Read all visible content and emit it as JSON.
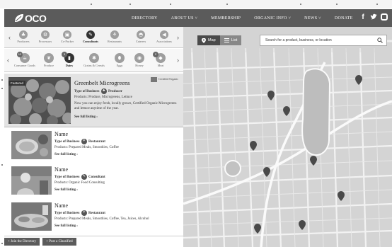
{
  "header": {
    "logo_text": "OCO",
    "nav": [
      "DIRECTORY",
      "ABOUT US ˅",
      "MEMBERSHIP",
      "ORGANIC INFO ˅",
      "NEWS ˅",
      "DONATE"
    ],
    "social": [
      "facebook-icon",
      "twitter-icon",
      "instagram-icon"
    ]
  },
  "categories": [
    {
      "label": "Producers",
      "icon": "producer-icon"
    },
    {
      "label": "Processors",
      "icon": "processor-icon"
    },
    {
      "label": "Co-Packer",
      "icon": "copacker-icon"
    },
    {
      "label": "Consultants",
      "icon": "consultant-icon",
      "active": true
    },
    {
      "label": "Restaurants",
      "icon": "restaurant-icon"
    },
    {
      "label": "Caterers",
      "icon": "caterer-icon"
    },
    {
      "label": "Associations",
      "icon": "association-icon"
    }
  ],
  "subcategories": [
    {
      "label": "Consumer Goods",
      "icon": "consumer-goods-icon",
      "badge": "12"
    },
    {
      "label": "Produce",
      "icon": "produce-icon"
    },
    {
      "label": "Dairy",
      "icon": "dairy-icon",
      "badge": "3",
      "active": true
    },
    {
      "label": "Grains & Cereals",
      "icon": "grains-icon"
    },
    {
      "label": "Eggs",
      "icon": "eggs-icon"
    },
    {
      "label": "Honey",
      "icon": "honey-icon"
    },
    {
      "label": "Meat",
      "icon": "meat-icon",
      "badge": "2"
    }
  ],
  "featured": {
    "tag": "Featured",
    "title": "Greenbelt Microgreens",
    "type_label": "Type of Business",
    "type_value": "Producer",
    "products_label": "Products:",
    "products_value": "Produce, Microgreens, Lettuce",
    "description": "Now you can enjoy fresh, locally grown, Certified Organic Microgreens and lettuce anytime of the year.",
    "more": "See full listing ›",
    "certified": "Certified Organic"
  },
  "listings": [
    {
      "name": "Name",
      "type_label": "Type of Business",
      "type_value": "Restaurant",
      "products": "Products: Prepared Meals, Smoothies, Coffee",
      "more": "See full listing ›"
    },
    {
      "name": "Name",
      "type_label": "Type of Business",
      "type_value": "Consultant",
      "products": "Products: Organic Food Consulting",
      "more": "See full listing ›"
    },
    {
      "name": "Name",
      "type_label": "Type of Business",
      "type_value": "Restaurant",
      "products": "Products: Prepared Meals, Smoothies, Coffee, Tea, Juices, Alcohol",
      "more": "See full listing ›"
    }
  ],
  "buttons": {
    "join": "+ Join the Directory",
    "classified": "+ Post a Classified"
  },
  "map": {
    "map_label": "Map",
    "list_label": "List",
    "search_placeholder": "Search for a product, business, or location"
  }
}
